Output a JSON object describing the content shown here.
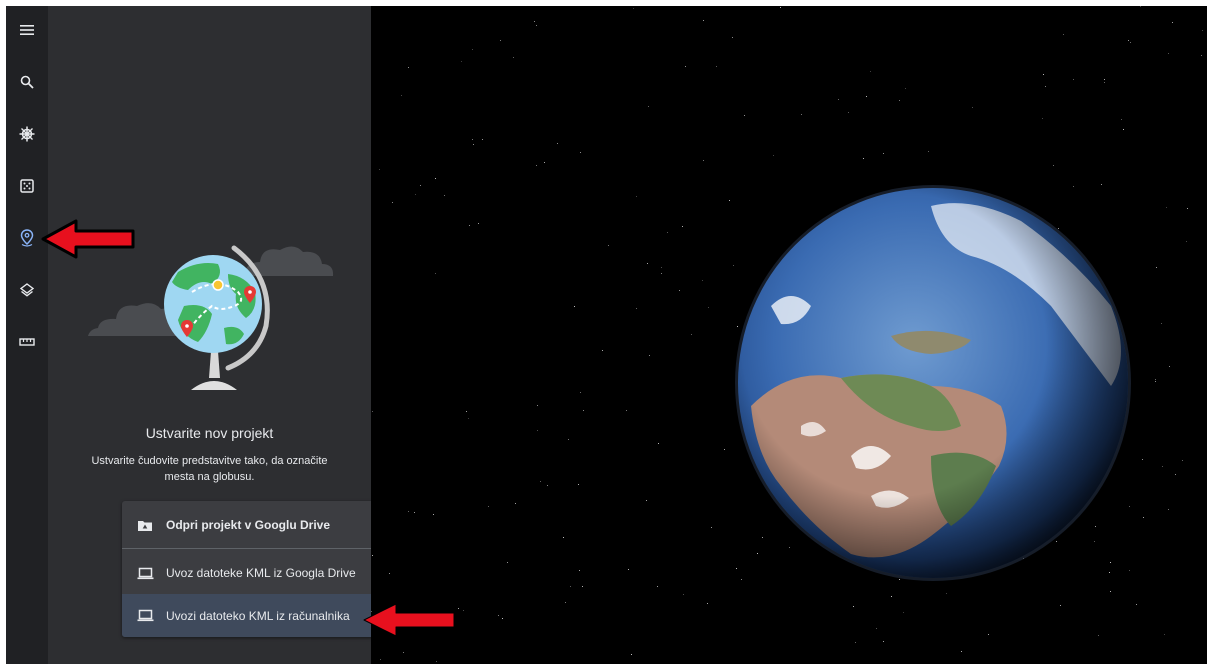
{
  "rail": {
    "items": [
      {
        "name": "menu-icon",
        "active": false
      },
      {
        "name": "search-icon",
        "active": false
      },
      {
        "name": "voyager-icon",
        "active": false
      },
      {
        "name": "feeling-lucky-icon",
        "active": false
      },
      {
        "name": "projects-icon",
        "active": true
      },
      {
        "name": "map-style-icon",
        "active": false
      },
      {
        "name": "measure-icon",
        "active": false
      }
    ],
    "active_color": "#8ab4f8",
    "icon_color": "#e8eaed"
  },
  "panel": {
    "title": "Ustvarite nov projekt",
    "subtitle": "Ustvarite čudovite predstavitve tako, da označite mesta na globusu.",
    "menu": {
      "open_drive": "Odpri projekt v Googlu Drive",
      "import_kml_drive": "Uvoz datoteke KML iz Googla Drive",
      "import_kml_computer": "Uvozi datoteko KML iz računalnika"
    }
  },
  "annotations": {
    "arrow_color": "#e8101e"
  }
}
